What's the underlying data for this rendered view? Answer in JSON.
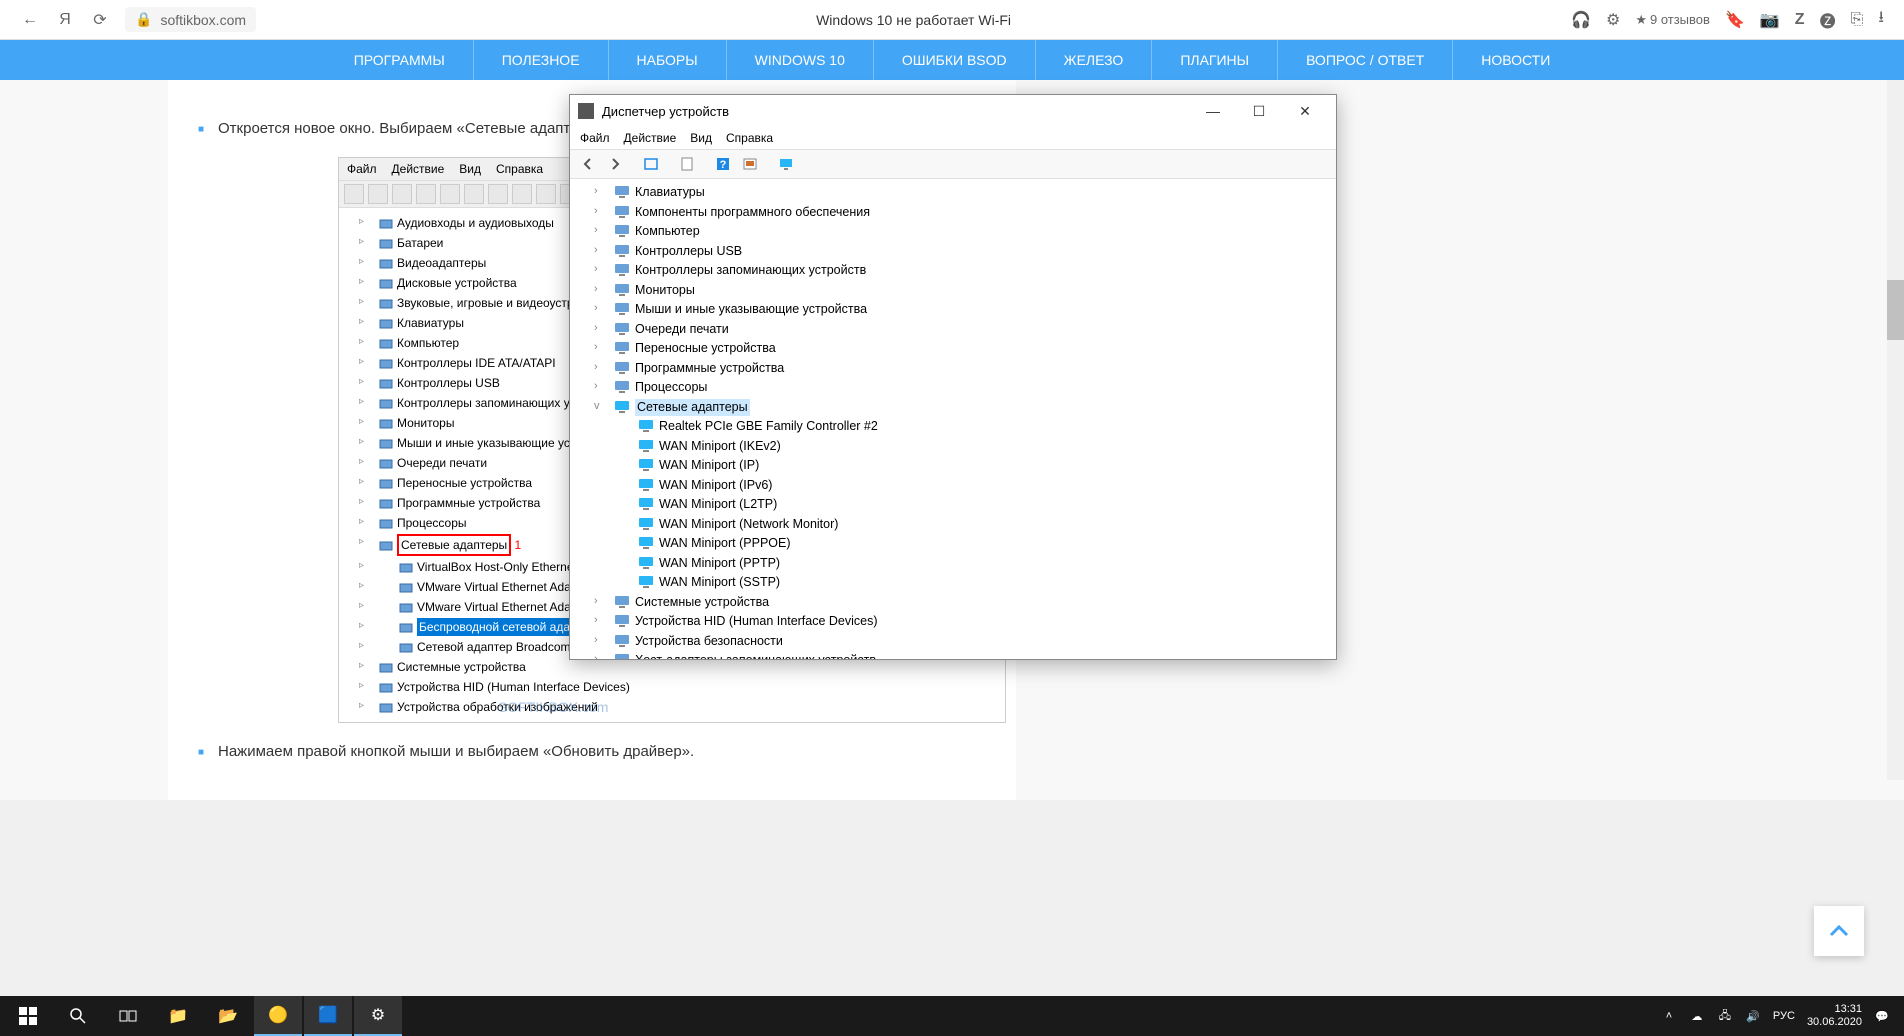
{
  "browser": {
    "url_host": "softikbox.com",
    "tab_title": "Windows 10 не работает Wi-Fi",
    "reviews_label": "9 отзывов"
  },
  "nav": [
    "ПРОГРАММЫ",
    "ПОЛЕЗНОЕ",
    "НАБОРЫ",
    "WINDOWS 10",
    "ОШИБКИ BSOD",
    "ЖЕЛЕЗО",
    "ПЛАГИНЫ",
    "ВОПРОС / ОТВЕТ",
    "НОВОСТИ"
  ],
  "article": {
    "p1": "Откроется новое окно. Выбираем «Сетевые адаптеры».",
    "p2": "Нажимаем правой кнопкой мыши и выбираем «Обновить драйвер».",
    "watermark": "SOFTIKBOX.com"
  },
  "old_screenshot": {
    "menu": [
      "Файл",
      "Действие",
      "Вид",
      "Справка"
    ],
    "tree": [
      "Аудиовходы и аудиовыходы",
      "Батареи",
      "Видеоадаптеры",
      "Дисковые устройства",
      "Звуковые, игровые и видеоустройств",
      "Клавиатуры",
      "Компьютер",
      "Контроллеры IDE ATA/ATAPI",
      "Контроллеры USB",
      "Контроллеры запоминающих устро",
      "Мониторы",
      "Мыши и иные указывающие устрой",
      "Очереди печати",
      "Переносные устройства",
      "Программные устройства",
      "Процессоры"
    ],
    "highlighted": "Сетевые адаптеры",
    "highlighted_num": "1",
    "children": [
      "VirtualBox Host-Only Ethernet Ada",
      "VMware Virtual Ethernet Adapter fo",
      "VMware Virtual Ethernet Adapter fo"
    ],
    "selected_child": "Беспроводной сетевой адаптер C",
    "after_children": [
      "Сетевой адаптер Broadcom NetLi"
    ],
    "after": [
      "Системные устройства",
      "Устройства HID (Human Interface Devices)",
      "Устройства обработки изображений"
    ]
  },
  "device_manager": {
    "title": "Диспетчер устройств",
    "menu": [
      "Файл",
      "Действие",
      "Вид",
      "Справка"
    ],
    "tree_top": [
      "Клавиатуры",
      "Компоненты программного обеспечения",
      "Компьютер",
      "Контроллеры USB",
      "Контроллеры запоминающих устройств",
      "Мониторы",
      "Мыши и иные указывающие устройства",
      "Очереди печати",
      "Переносные устройства",
      "Программные устройства",
      "Процессоры"
    ],
    "expanded": "Сетевые адаптеры",
    "adapters": [
      "Realtek PCIe GBE Family Controller #2",
      "WAN Miniport (IKEv2)",
      "WAN Miniport (IP)",
      "WAN Miniport (IPv6)",
      "WAN Miniport (L2TP)",
      "WAN Miniport (Network Monitor)",
      "WAN Miniport (PPPOE)",
      "WAN Miniport (PPTP)",
      "WAN Miniport (SSTP)"
    ],
    "tree_bottom": [
      "Системные устройства",
      "Устройства HID (Human Interface Devices)",
      "Устройства безопасности",
      "Хост-адаптеры запоминающих устройств"
    ]
  },
  "taskbar": {
    "lang": "РУС",
    "time": "13:31",
    "date": "30.06.2020"
  }
}
